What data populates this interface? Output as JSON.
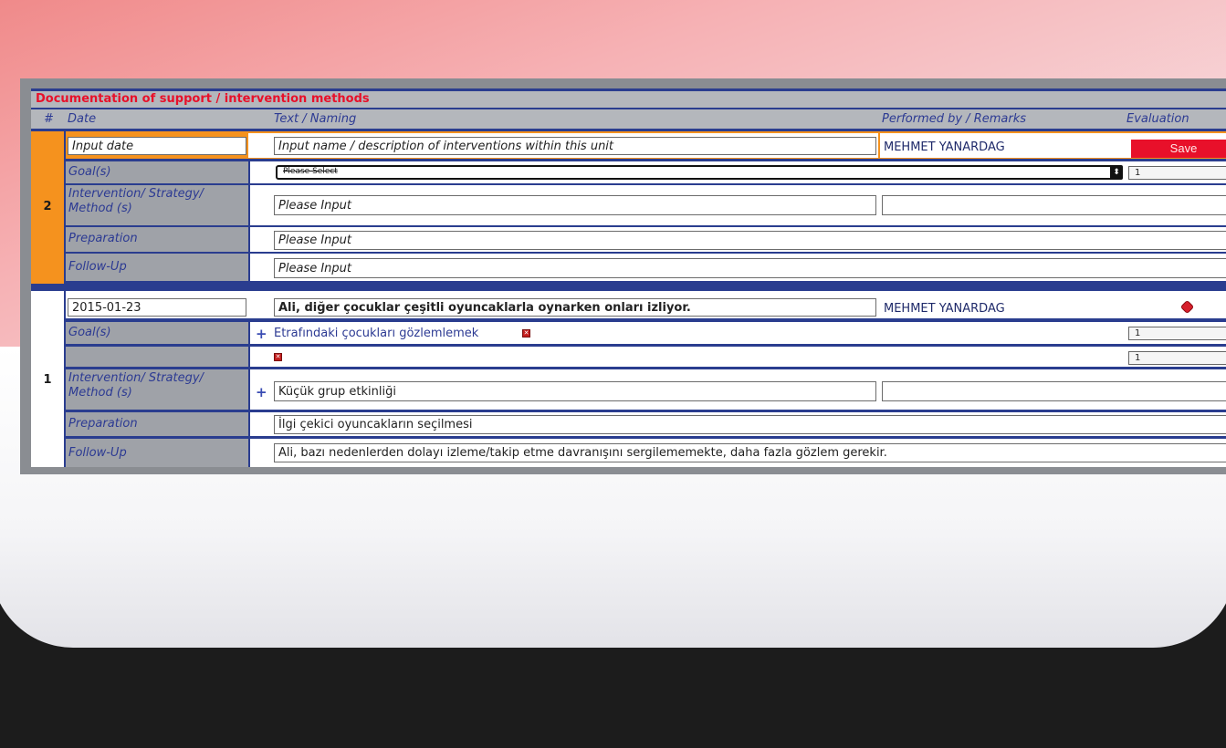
{
  "section_title": "Documentation of support / intervention methods",
  "columns": {
    "num": "#",
    "date": "Date",
    "text": "Text / Naming",
    "performed": "Performed by / Remarks",
    "evaluation": "Evaluation"
  },
  "new_entry": {
    "number": "2",
    "date_placeholder": "Input date",
    "text_placeholder": "Input name / description of interventions within this unit",
    "performed_by": "MEHMET YANARDAG",
    "save_label": "Save",
    "goal_label": "Goal(s)",
    "goal_select_value": "Please Select",
    "goal_select_arrow": "⬍",
    "goal_eval": "1",
    "method_label": "Intervention/ Strategy/ Method (s)",
    "method_placeholder": "Please Input",
    "preparation_label": "Preparation",
    "preparation_placeholder": "Please Input",
    "followup_label": "Follow-Up",
    "followup_placeholder": "Please Input"
  },
  "entry": {
    "number": "1",
    "date": "2015-01-23",
    "text": "Ali, diğer çocuklar çeşitli oyuncaklarla oynarken onları izliyor.",
    "performed_by": "MEHMET YANARDAG",
    "goal_label": "Goal(s)",
    "add_symbol": "+",
    "goal_text": "Etrafındaki çocukları gözlemlemek",
    "goal_eval_1": "1",
    "goal_eval_2": "1",
    "method_label": "Intervention/ Strategy/ Method (s)",
    "method_text": "Küçük grup etkinliği",
    "preparation_label": "Preparation",
    "preparation_text": "İlgi çekici oyuncakların seçilmesi",
    "followup_label": "Follow-Up",
    "followup_text": "Ali, bazı nedenlerden dolayı izleme/takip etme davranışını sergilememekte, daha fazla gözlem gerekir."
  },
  "colors": {
    "accent_red": "#e8102a",
    "new_entry_orange": "#f5921e",
    "row_border_blue": "#2a3d8f",
    "label_gray": "#9fa2a8"
  }
}
